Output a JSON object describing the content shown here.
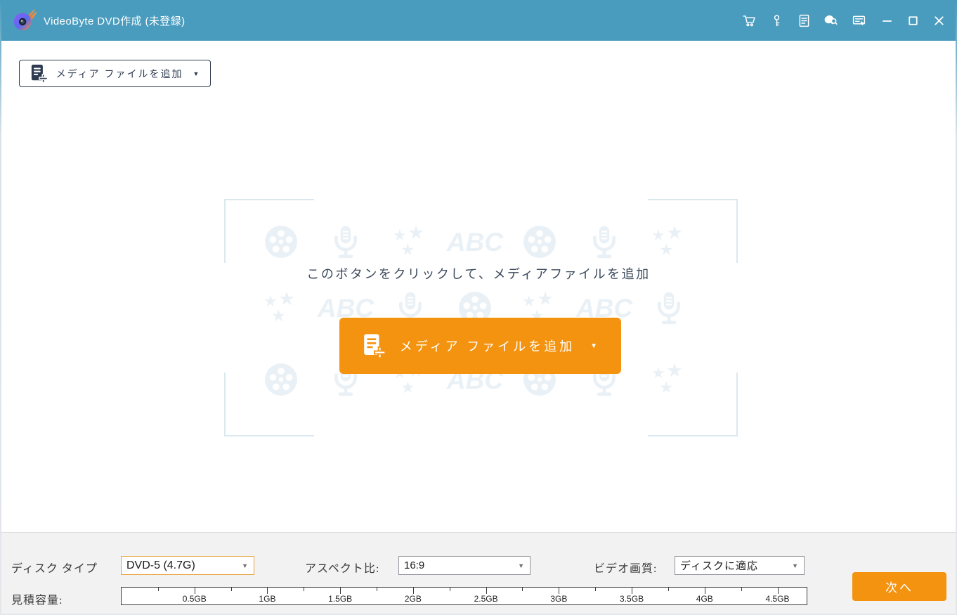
{
  "app": {
    "title": "VideoByte DVD作成 (未登録)"
  },
  "titlebar": {
    "icons": [
      "cart",
      "key",
      "register",
      "feedback",
      "menu"
    ],
    "window_controls": [
      "minimize",
      "maximize",
      "close"
    ]
  },
  "toolbar": {
    "add_media_label": "メディア ファイルを追加"
  },
  "dropzone": {
    "instruction": "このボタンをクリックして、メディアファイルを追加",
    "add_media_label": "メディア ファイルを追加",
    "watermark": {
      "abc_text": "ABC",
      "star_glyph": "★",
      "rows": [
        [
          "film",
          "mic",
          "stars",
          "abc",
          "film",
          "mic",
          "stars"
        ],
        [
          "stars",
          "abc",
          "mic",
          "film",
          "stars",
          "abc",
          "mic"
        ],
        [
          "film",
          "mic",
          "stars",
          "abc",
          "film",
          "mic",
          "stars"
        ]
      ]
    }
  },
  "settings": {
    "disc_type": {
      "label": "ディスク タイプ",
      "value": "DVD-5 (4.7G)"
    },
    "aspect_ratio": {
      "label": "アスペクト比:",
      "value": "16:9"
    },
    "video_quality": {
      "label": "ビデオ画質:",
      "value": "ディスクに適応"
    }
  },
  "capacity": {
    "label": "見積容量:",
    "ruler": {
      "min": 0,
      "max": 4.7,
      "unit": "GB",
      "minor_step": 0.25,
      "major_step": 0.5,
      "labels": [
        {
          "value": 0.5,
          "text": "0.5GB"
        },
        {
          "value": 1.0,
          "text": "1GB"
        },
        {
          "value": 1.5,
          "text": "1.5GB"
        },
        {
          "value": 2.0,
          "text": "2GB"
        },
        {
          "value": 2.5,
          "text": "2.5GB"
        },
        {
          "value": 3.0,
          "text": "3GB"
        },
        {
          "value": 3.5,
          "text": "3.5GB"
        },
        {
          "value": 4.0,
          "text": "4GB"
        },
        {
          "value": 4.5,
          "text": "4.5GB"
        }
      ]
    }
  },
  "next_button": {
    "label": "次へ"
  },
  "colors": {
    "titlebar": "#4A9CBE",
    "accent": "#F3930F",
    "navy": "#2E3A50",
    "watermark": "#EAF1F6",
    "frame": "#DCE8F0",
    "select_orange": "#E8A33D"
  }
}
